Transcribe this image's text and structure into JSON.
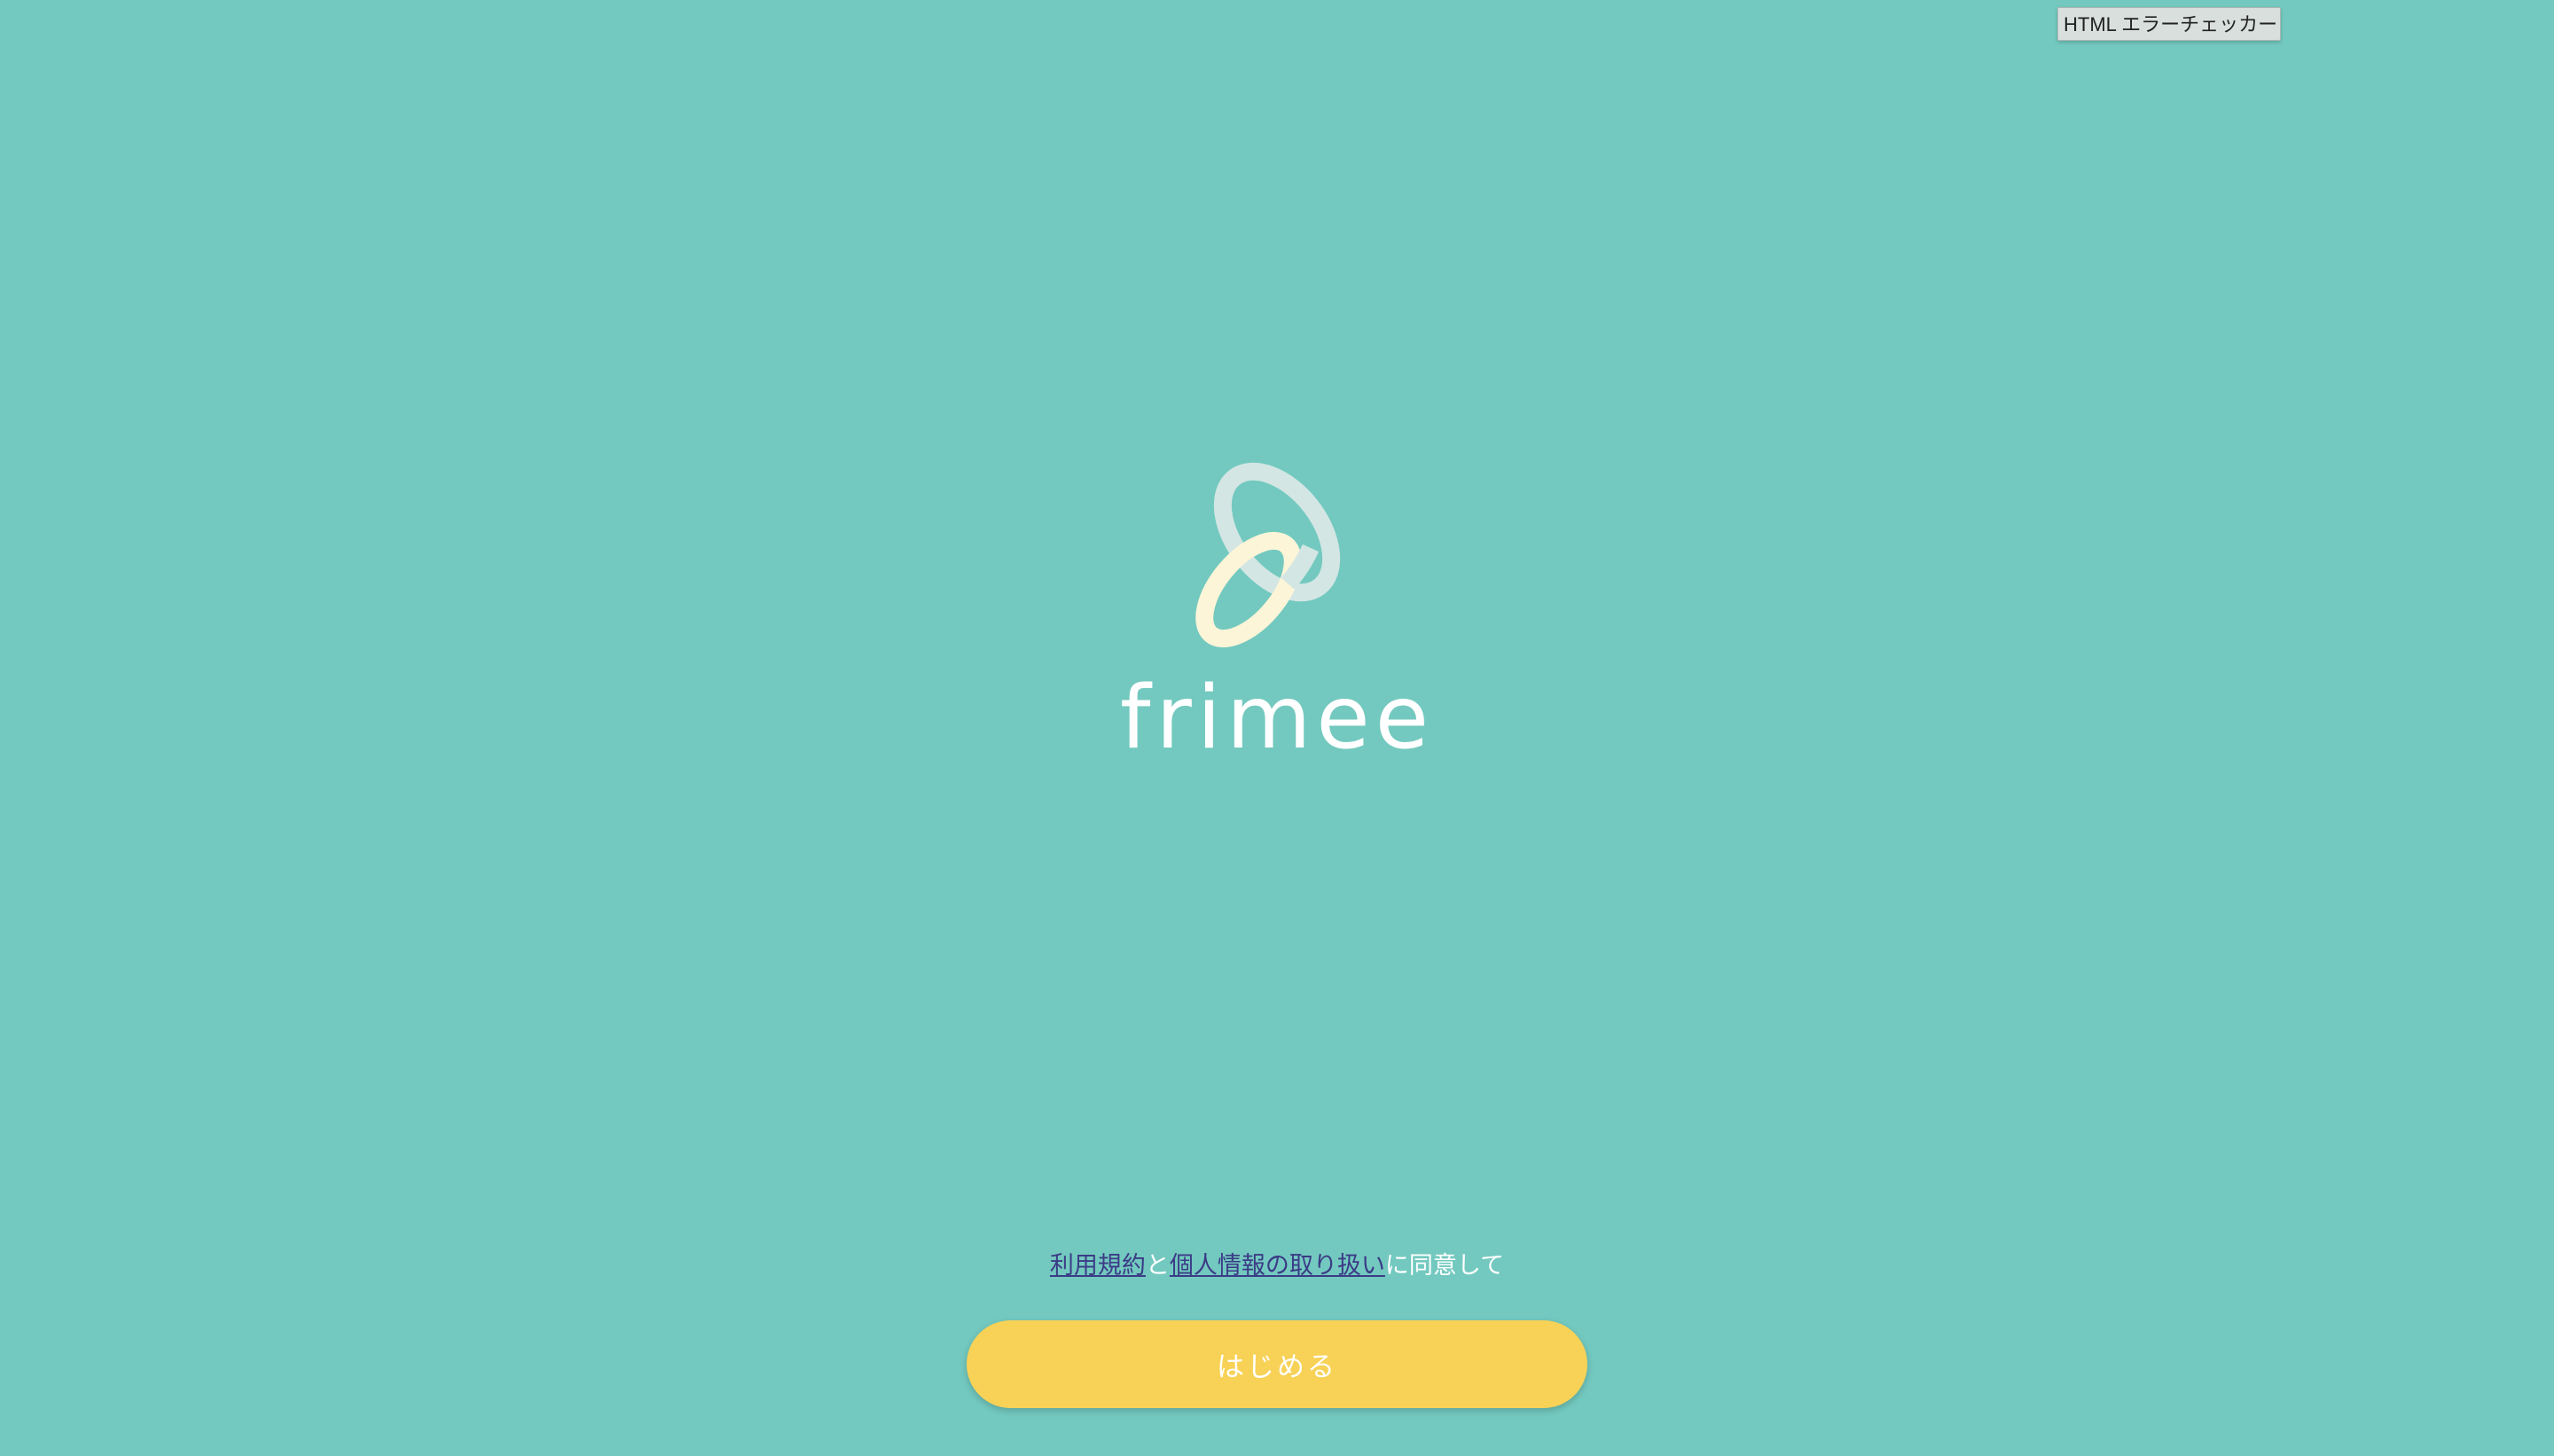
{
  "debug": {
    "error_checker_label": "HTML エラーチェッカー"
  },
  "brand": {
    "name": "frimee",
    "logo_icon": "two-interlocking-rings-icon"
  },
  "consent": {
    "terms_link": "利用規約",
    "connector": "と",
    "privacy_link": "個人情報の取り扱い",
    "suffix": "に同意して"
  },
  "start_button": {
    "label": "はじめる"
  },
  "colors": {
    "background": "#73c9bf",
    "ring_back": "#d3e6e4",
    "ring_front": "#fdf5d8",
    "button": "#f7d257",
    "link": "#3b3b86",
    "text": "#ffffff"
  }
}
